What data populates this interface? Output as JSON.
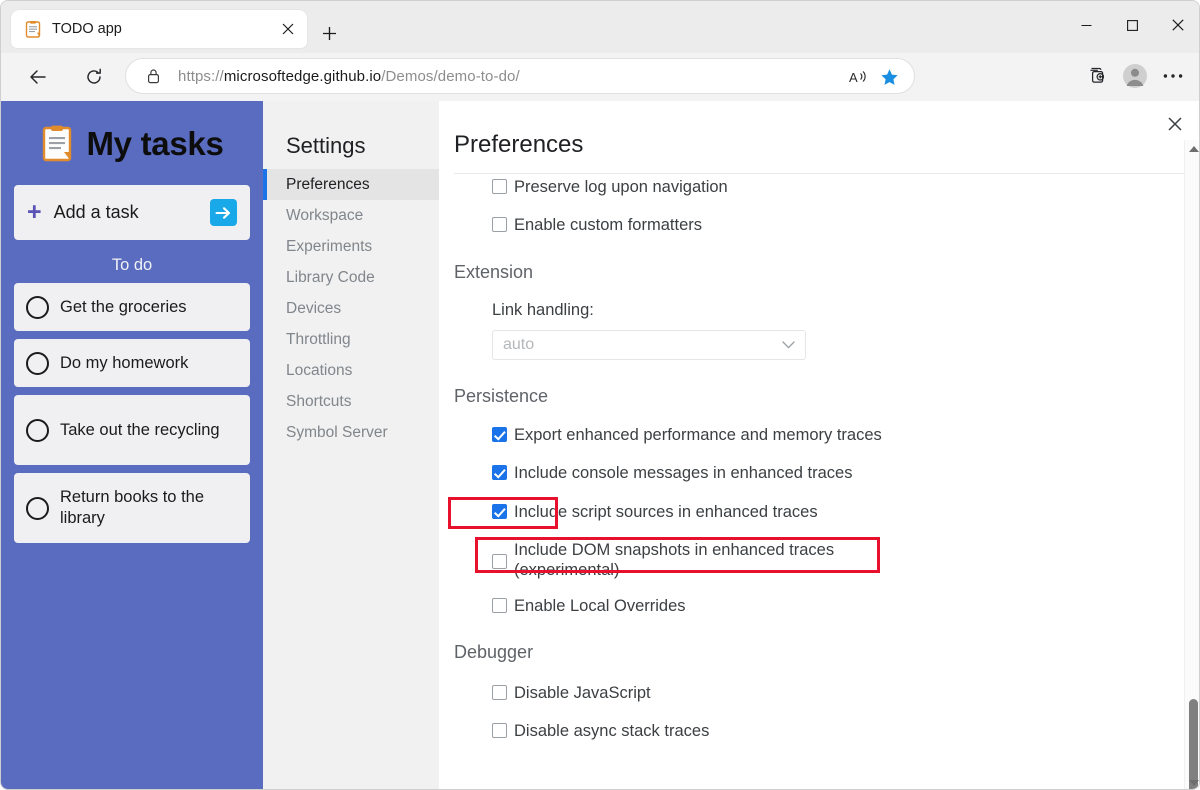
{
  "browser": {
    "tab": {
      "title": "TODO app",
      "favicon": "clipboard-icon",
      "close_label": "×"
    },
    "new_tab_label": "+",
    "caption": {
      "minimize": "–",
      "maximize": "□",
      "close": "✕"
    },
    "nav": {
      "back": "←",
      "refresh": "↻"
    },
    "address": {
      "lock_icon": "lock-icon",
      "scheme": "https://",
      "host": "microsoftedge.github.io",
      "path": "/Demos/demo-to-do/",
      "full_url": "https://microsoftedge.github.io/Demos/demo-to-do/",
      "read_aloud_icon": "read-aloud-icon",
      "favorite_icon": "star-filled-icon"
    },
    "toolbar": {
      "collections_icon": "collections-icon",
      "profile_icon": "profile-avatar-icon",
      "settings_more_icon": "ellipsis-icon"
    }
  },
  "todo_app": {
    "logo_icon": "clipboard-icon",
    "title": "My tasks",
    "add_task": {
      "plus": "+",
      "label": "Add a task",
      "submit_icon": "arrow-right-icon"
    },
    "section_title": "To do",
    "tasks": [
      {
        "label": "Get the groceries",
        "done": false
      },
      {
        "label": "Do my homework",
        "done": false
      },
      {
        "label": "Take out the recycling",
        "done": false
      },
      {
        "label": "Return books to the library",
        "done": false
      }
    ]
  },
  "settings": {
    "close_label": "✕",
    "nav_title": "Settings",
    "nav_items": [
      {
        "label": "Preferences",
        "active": true
      },
      {
        "label": "Workspace",
        "active": false
      },
      {
        "label": "Experiments",
        "active": false
      },
      {
        "label": "Library Code",
        "active": false
      },
      {
        "label": "Devices",
        "active": false
      },
      {
        "label": "Throttling",
        "active": false
      },
      {
        "label": "Locations",
        "active": false
      },
      {
        "label": "Shortcuts",
        "active": false
      },
      {
        "label": "Symbol Server",
        "active": false
      }
    ],
    "content_title": "Preferences",
    "console_checkboxes": [
      {
        "label": "Preserve log upon navigation",
        "checked": false
      },
      {
        "label": "Enable custom formatters",
        "checked": false
      }
    ],
    "extension": {
      "group_title": "Extension",
      "link_handling_label": "Link handling:",
      "link_handling_value": "auto",
      "chevron_icon": "chevron-down-icon"
    },
    "persistence": {
      "group_title": "Persistence",
      "checkboxes": [
        {
          "label": "Export enhanced performance and memory traces",
          "checked": true
        },
        {
          "label": "Include console messages in enhanced traces",
          "checked": true
        },
        {
          "label": "Include script sources in enhanced traces",
          "checked": true
        },
        {
          "label": "Include DOM snapshots in enhanced traces (experimental)",
          "checked": false
        },
        {
          "label": "Enable Local Overrides",
          "checked": false
        }
      ]
    },
    "debugger": {
      "group_title": "Debugger",
      "checkboxes": [
        {
          "label": "Disable JavaScript",
          "checked": false
        },
        {
          "label": "Disable async stack traces",
          "checked": false
        }
      ]
    },
    "scrollbar": {
      "up_arrow": "scroll-up-arrow",
      "down_arrow": "scroll-down-arrow"
    }
  },
  "annotations": {
    "highlight_color": "#e8112d",
    "boxes": [
      {
        "target": "persistence-group-title"
      },
      {
        "target": "export-enhanced-traces-checkbox-row"
      }
    ]
  },
  "colors": {
    "todo_sidebar": "#5a6cc0",
    "accent_blue": "#1a73e8",
    "submit_cyan": "#19a9e8",
    "highlight_red": "#e8112d"
  }
}
